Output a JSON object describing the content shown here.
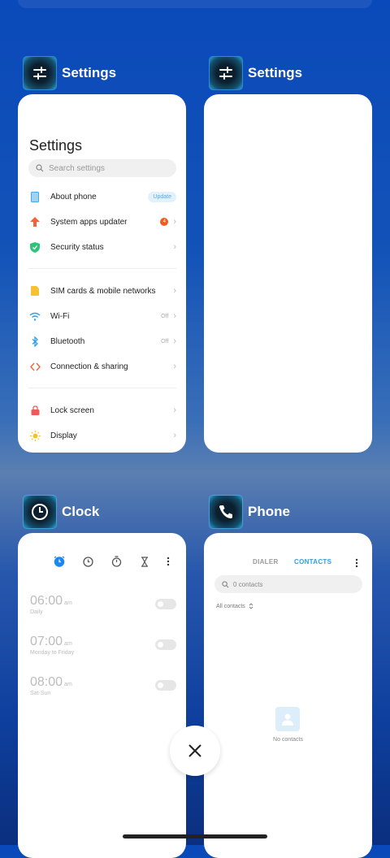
{
  "recents": [
    {
      "app_title": "Settings",
      "icon": "sliders-icon"
    },
    {
      "app_title": "Settings",
      "icon": "sliders-icon"
    },
    {
      "app_title": "Clock",
      "icon": "clock-icon"
    },
    {
      "app_title": "Phone",
      "icon": "phone-icon"
    }
  ],
  "settings_card": {
    "title": "Settings",
    "search_placeholder": "Search settings",
    "items": [
      {
        "label": "About phone",
        "badge": "Update",
        "icon": "phone-info-icon"
      },
      {
        "label": "System apps updater",
        "badge": "4",
        "icon": "arrow-up-icon"
      },
      {
        "label": "Security status",
        "icon": "shield-check-icon"
      },
      {
        "label": "SIM cards & mobile networks",
        "icon": "sim-card-icon"
      },
      {
        "label": "Wi-Fi",
        "value": "Off",
        "icon": "wifi-icon"
      },
      {
        "label": "Bluetooth",
        "value": "Off",
        "icon": "bluetooth-icon"
      },
      {
        "label": "Connection & sharing",
        "icon": "connection-sharing-icon"
      },
      {
        "label": "Lock screen",
        "icon": "lock-icon"
      },
      {
        "label": "Display",
        "icon": "sun-icon"
      }
    ]
  },
  "clock_card": {
    "tabs": [
      "alarm-icon",
      "clock-icon",
      "stopwatch-icon",
      "timer-icon",
      "more-icon"
    ],
    "alarms": [
      {
        "time": "06:00",
        "ampm": "am",
        "repeat": "Daily",
        "enabled": false
      },
      {
        "time": "07:00",
        "ampm": "am",
        "repeat": "Monday to Friday",
        "enabled": false
      },
      {
        "time": "08:00",
        "ampm": "am",
        "repeat": "Sat-Sun",
        "enabled": false
      }
    ]
  },
  "phone_card": {
    "tab_dialer": "DIALER",
    "tab_contacts": "CONTACTS",
    "search_placeholder": "0 contacts",
    "filter": "All contacts",
    "empty_text": "No contacts"
  },
  "colors": {
    "accent_blue": "#2f9ee5",
    "clock_accent": "#1d86f0",
    "badge_orange": "#f25a1e"
  }
}
